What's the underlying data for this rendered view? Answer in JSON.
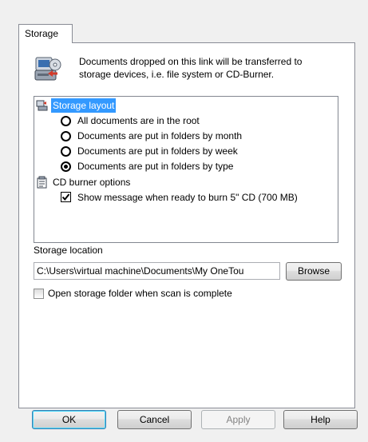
{
  "tab": {
    "label": "Storage"
  },
  "description": "Documents dropped on this link will be transferred to\nstorage devices, i.e. file system or CD-Burner.",
  "tree": {
    "storage_layout": {
      "label": "Storage layout",
      "options": [
        {
          "label": "All documents are in the root",
          "checked": false
        },
        {
          "label": "Documents are put in folders by month",
          "checked": false
        },
        {
          "label": "Documents are put in folders by week",
          "checked": false
        },
        {
          "label": "Documents are put in folders by type",
          "checked": true
        }
      ]
    },
    "cd_burner": {
      "label": "CD burner options",
      "option": {
        "label": "Show message when ready to burn 5\" CD (700 MB)",
        "checked": true
      }
    }
  },
  "storage_location": {
    "label": "Storage location",
    "value": "C:\\Users\\virtual machine\\Documents\\My OneTou",
    "browse_label": "Browse"
  },
  "open_folder": {
    "label": "Open storage folder when scan is complete",
    "checked": false
  },
  "buttons": {
    "ok": "OK",
    "cancel": "Cancel",
    "apply": "Apply",
    "help": "Help"
  },
  "colors": {
    "selection": "#3399ff",
    "default_button_border": "#3c7fb1"
  }
}
